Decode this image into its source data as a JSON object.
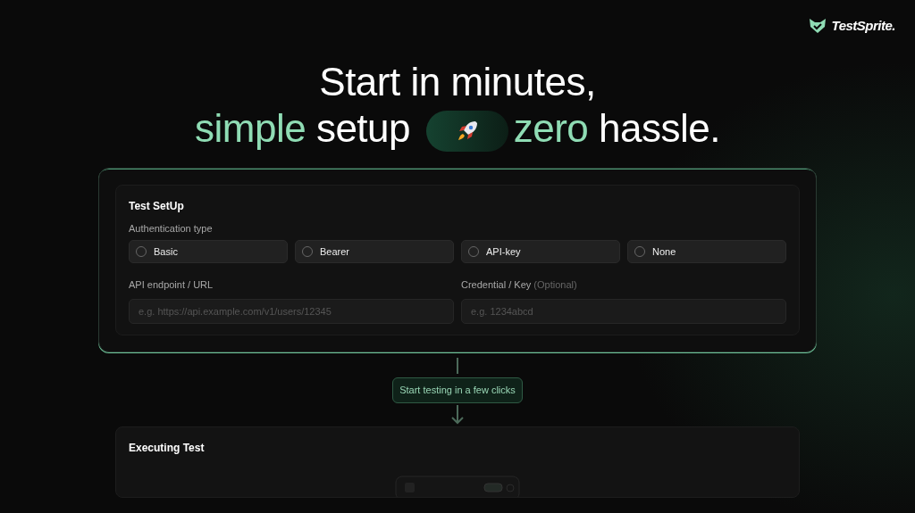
{
  "brand": {
    "name": "TestSprite."
  },
  "headline": {
    "line_1": "Start in minutes,",
    "line_2": [
      {
        "text": "simple",
        "accent": true
      },
      {
        "text": "setup",
        "accent": false
      },
      {
        "kind": "pill"
      },
      {
        "text": "zero",
        "accent": true
      },
      {
        "text": "hassle.",
        "accent": false
      }
    ]
  },
  "setup_card": {
    "title": "Test SetUp",
    "auth_label": "Authentication type",
    "auth_options": [
      {
        "label": "Basic",
        "selected": false
      },
      {
        "label": "Bearer",
        "selected": false
      },
      {
        "label": "API-key",
        "selected": false
      },
      {
        "label": "None",
        "selected": false
      }
    ],
    "fields": [
      {
        "label": "API endpoint / URL",
        "placeholder": "e.g. https://api.example.com/v1/users/12345"
      },
      {
        "label": "Credential / Key",
        "note": "(Optional)",
        "placeholder": "e.g. 1234abcd"
      }
    ]
  },
  "connector": {
    "label": "Start testing in a few clicks"
  },
  "executing_card": {
    "title": "Executing Test"
  }
}
